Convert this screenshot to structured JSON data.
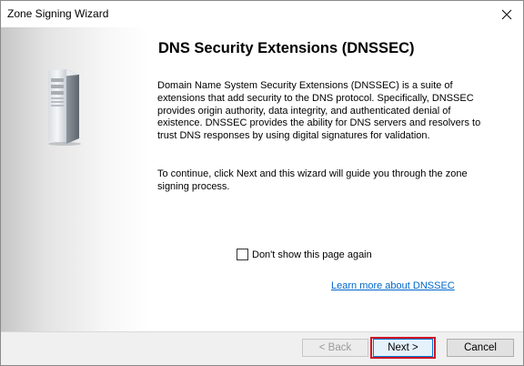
{
  "window": {
    "title": "Zone Signing Wizard",
    "close_glyph": "✕"
  },
  "content": {
    "heading": "DNS Security Extensions (DNSSEC)",
    "paragraph1": "Domain Name System Security Extensions (DNSSEC) is a suite of extensions that add security to the DNS protocol. Specifically, DNSSEC provides origin authority, data integrity, and authenticated denial of existence. DNSSEC provides the ability for DNS servers and resolvers to trust DNS responses by using digital signatures for validation.",
    "paragraph2": "To continue, click Next and this wizard will guide you through the zone signing process.",
    "checkbox_label": "Don't show this page again",
    "checkbox_checked": false,
    "link_text": "Learn more about DNSSEC"
  },
  "buttons": {
    "back": "< Back",
    "next": "Next >",
    "cancel": "Cancel"
  },
  "icons": {
    "close": "close-icon",
    "art": "server-tower-icon"
  },
  "colors": {
    "link": "#0066cc",
    "focus_highlight": "#d01525",
    "default_button_border": "#0078d7"
  }
}
